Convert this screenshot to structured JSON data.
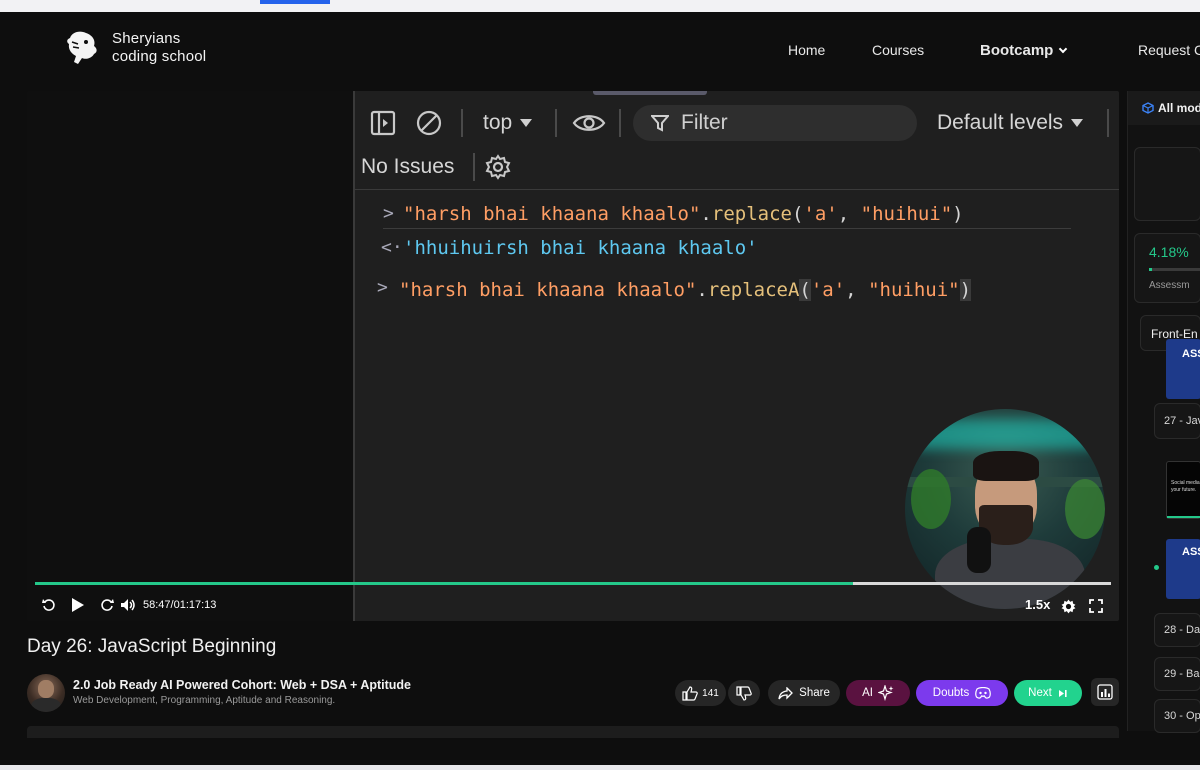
{
  "header": {
    "logo_line1": "Sheryians",
    "logo_line2": "coding school",
    "nav": {
      "home": "Home",
      "courses": "Courses",
      "bootcamp": "Bootcamp",
      "request": "Request C"
    }
  },
  "devtools": {
    "context": "top",
    "filter_placeholder": "Filter",
    "levels": "Default levels",
    "issues": "No Issues",
    "console": [
      {
        "prompt": ">",
        "str": "\"harsh bhai khaana khaalo\"",
        "dot": ".",
        "fn": "replace",
        "args_open": "(",
        "arg1": "'a'",
        "comma": ", ",
        "arg2": "\"huihui\"",
        "args_close": ")"
      },
      {
        "prompt": "<·",
        "output": "'hhuihuirsh bhai khaana khaalo'"
      },
      {
        "prompt": ">",
        "str": "\"harsh bhai khaana khaalo\"",
        "dot": ".",
        "fn": "replaceA",
        "args_open": "(",
        "arg1": "'a'",
        "comma": ", ",
        "arg2": "\"huihui\"",
        "args_close": ")"
      }
    ]
  },
  "player": {
    "time": "58:47/01:17:13",
    "progress": 0.76,
    "speed": "1.5x"
  },
  "video_title": "Day 26: JavaScript Beginning",
  "course": {
    "title": "2.0 Job Ready AI Powered Cohort: Web + DSA + Aptitude",
    "subtitle": "Web Development, Programming, Aptitude and Reasoning."
  },
  "actions": {
    "likes": "141",
    "share": "Share",
    "ai": "AI",
    "doubts": "Doubts",
    "next": "Next"
  },
  "sidebar": {
    "header": "All mod",
    "progress_percent": "4.18%",
    "progress_fraction": 0.0418,
    "assess_label": "Assessm",
    "section": "Front-En",
    "items": [
      "27 - Jav",
      "28 - Da",
      "29 - Ba",
      "30 - Op"
    ],
    "thumb_label": "ASS",
    "thumb_text": "Social media your future."
  },
  "colors": {
    "accent_green": "#24c88a",
    "ai_pill": "#5a1240",
    "doubts_pill": "#7c3aed",
    "next_pill": "#22d38e"
  }
}
